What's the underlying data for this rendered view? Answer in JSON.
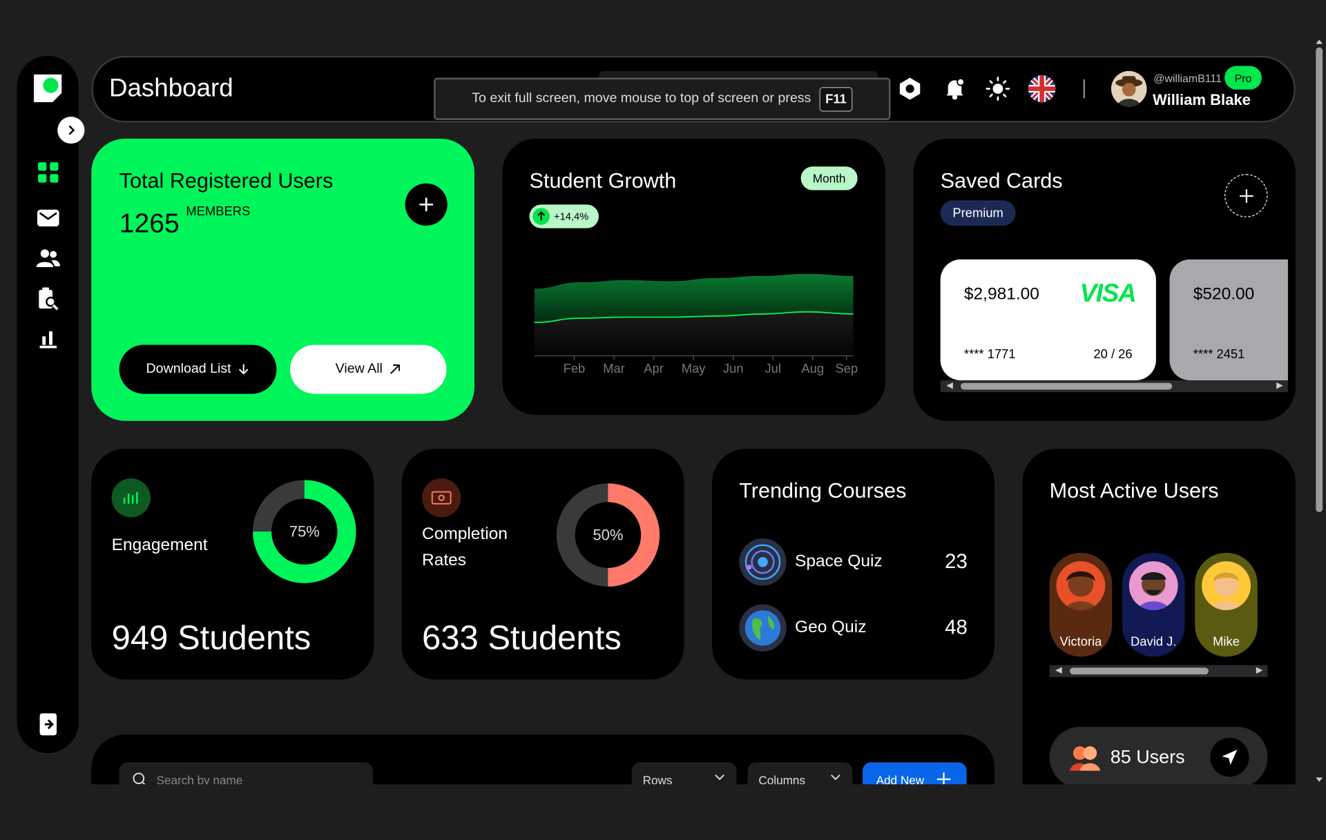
{
  "header": {
    "title": "Dashboard",
    "fullscreen_notice": "To exit full screen, move mouse to top of screen or press",
    "fullscreen_key": "F11",
    "user_handle": "@williamB111",
    "user_name": "William Blake",
    "badge": "Pro"
  },
  "sidebar": {
    "items": [
      "grid-icon",
      "mail-icon",
      "users-icon",
      "search-doc-icon",
      "chart-icon"
    ],
    "logout_icon": "logout-icon"
  },
  "registered": {
    "title": "Total Registered Users",
    "count": "1265",
    "unit": "MEMBERS",
    "download_label": "Download List",
    "view_all_label": "View All"
  },
  "growth": {
    "title": "Student Growth",
    "period": "Month",
    "change": "+14,4%"
  },
  "chart_data": {
    "type": "area",
    "categories": [
      "Feb",
      "Mar",
      "Apr",
      "May",
      "Jun",
      "Jul",
      "Aug",
      "Sep"
    ],
    "series": [
      {
        "values": [
          62,
          68,
          70,
          69,
          72,
          74,
          76,
          74
        ]
      },
      {
        "values": [
          30,
          34,
          35,
          35,
          36,
          38,
          40,
          38
        ]
      }
    ],
    "colors": [
      "#00c94a",
      "#00f55a"
    ],
    "title": "",
    "xlabel": "",
    "ylabel": "",
    "ylim": [
      0,
      100
    ],
    "grid": false
  },
  "saved_cards": {
    "title": "Saved Cards",
    "tier": "Premium",
    "cards": [
      {
        "amount": "$2,981.00",
        "number": "**** 1771",
        "expiry": "20 / 26",
        "brand": "VISA"
      },
      {
        "amount": "$520.00",
        "number": "**** 2451"
      }
    ]
  },
  "engagement": {
    "label": "Engagement",
    "percent": "75%",
    "fraction": 0.75,
    "total": "949 Students",
    "color": "#00f55a"
  },
  "completion": {
    "label_line1": "Completion",
    "label_line2": "Rates",
    "percent": "50%",
    "fraction": 0.5,
    "total": "633 Students",
    "color": "#ff7a6b"
  },
  "trending": {
    "title": "Trending Courses",
    "courses": [
      {
        "name": "Space Quiz",
        "count": "23"
      },
      {
        "name": "Geo Quiz",
        "count": "48"
      }
    ]
  },
  "active_users": {
    "title": "Most Active Users",
    "users": [
      {
        "name": "Victoria",
        "bg": "#5a2a10",
        "face": "#e8502a"
      },
      {
        "name": "David J.",
        "bg": "#111a55",
        "face": "#e89ad0"
      },
      {
        "name": "Mike",
        "bg": "#5a5a10",
        "face": "#ffc83a"
      }
    ],
    "total": "85 Users"
  },
  "table": {
    "search_placeholder": "Search by name",
    "rows_label": "Rows",
    "columns_label": "Columns",
    "add_label": "Add New"
  }
}
